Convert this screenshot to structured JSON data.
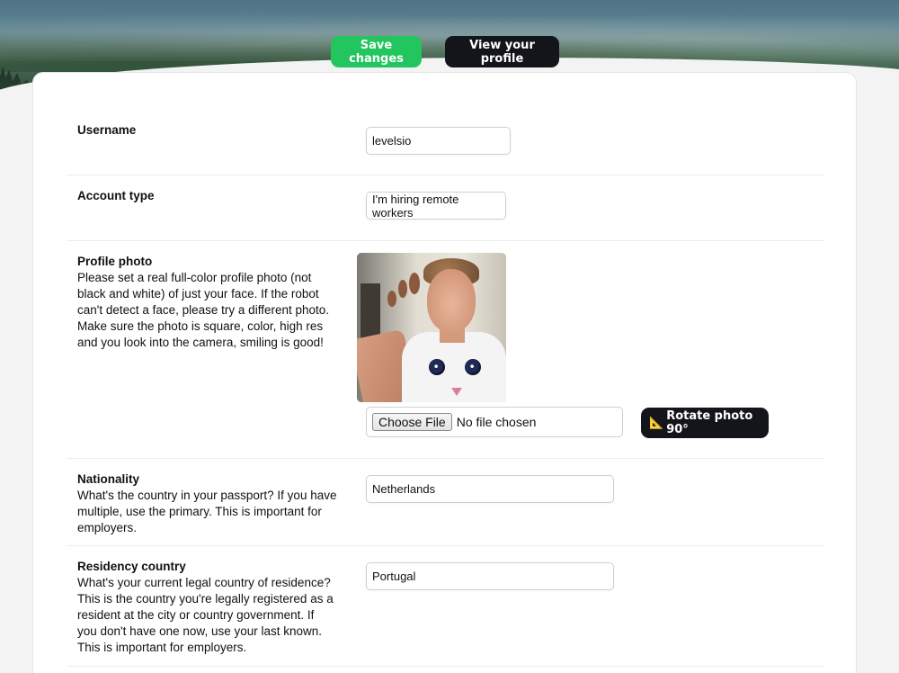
{
  "header": {
    "save_label": "Save changes",
    "view_profile_label": "View your profile"
  },
  "form": {
    "username": {
      "title": "Username",
      "value": "levelsio"
    },
    "account_type": {
      "title": "Account type",
      "value": "I'm hiring remote workers"
    },
    "profile_photo": {
      "title": "Profile photo",
      "description": "Please set a real full-color profile photo (not black and white) of just your face. If the robot can't detect a face, please try a different photo. Make sure the photo is square, color, high res and you look into the camera, smiling is good!",
      "choose_file_label": "Choose File",
      "file_status": "No file chosen",
      "rotate_icon": "📐",
      "rotate_label": "Rotate photo 90°"
    },
    "nationality": {
      "title": "Nationality",
      "description": "What's the country in your passport? If you have multiple, use the primary. This is important for employers.",
      "value": "Netherlands"
    },
    "residency": {
      "title": "Residency country",
      "description": "What's your current legal country of residence? This is the country you're legally registered as a resident at the city or country government. If you don't have one now, use your last known. This is important for employers.",
      "value": "Portugal"
    }
  },
  "colors": {
    "accent_green": "#22c55e",
    "dark_button": "#14151a"
  }
}
